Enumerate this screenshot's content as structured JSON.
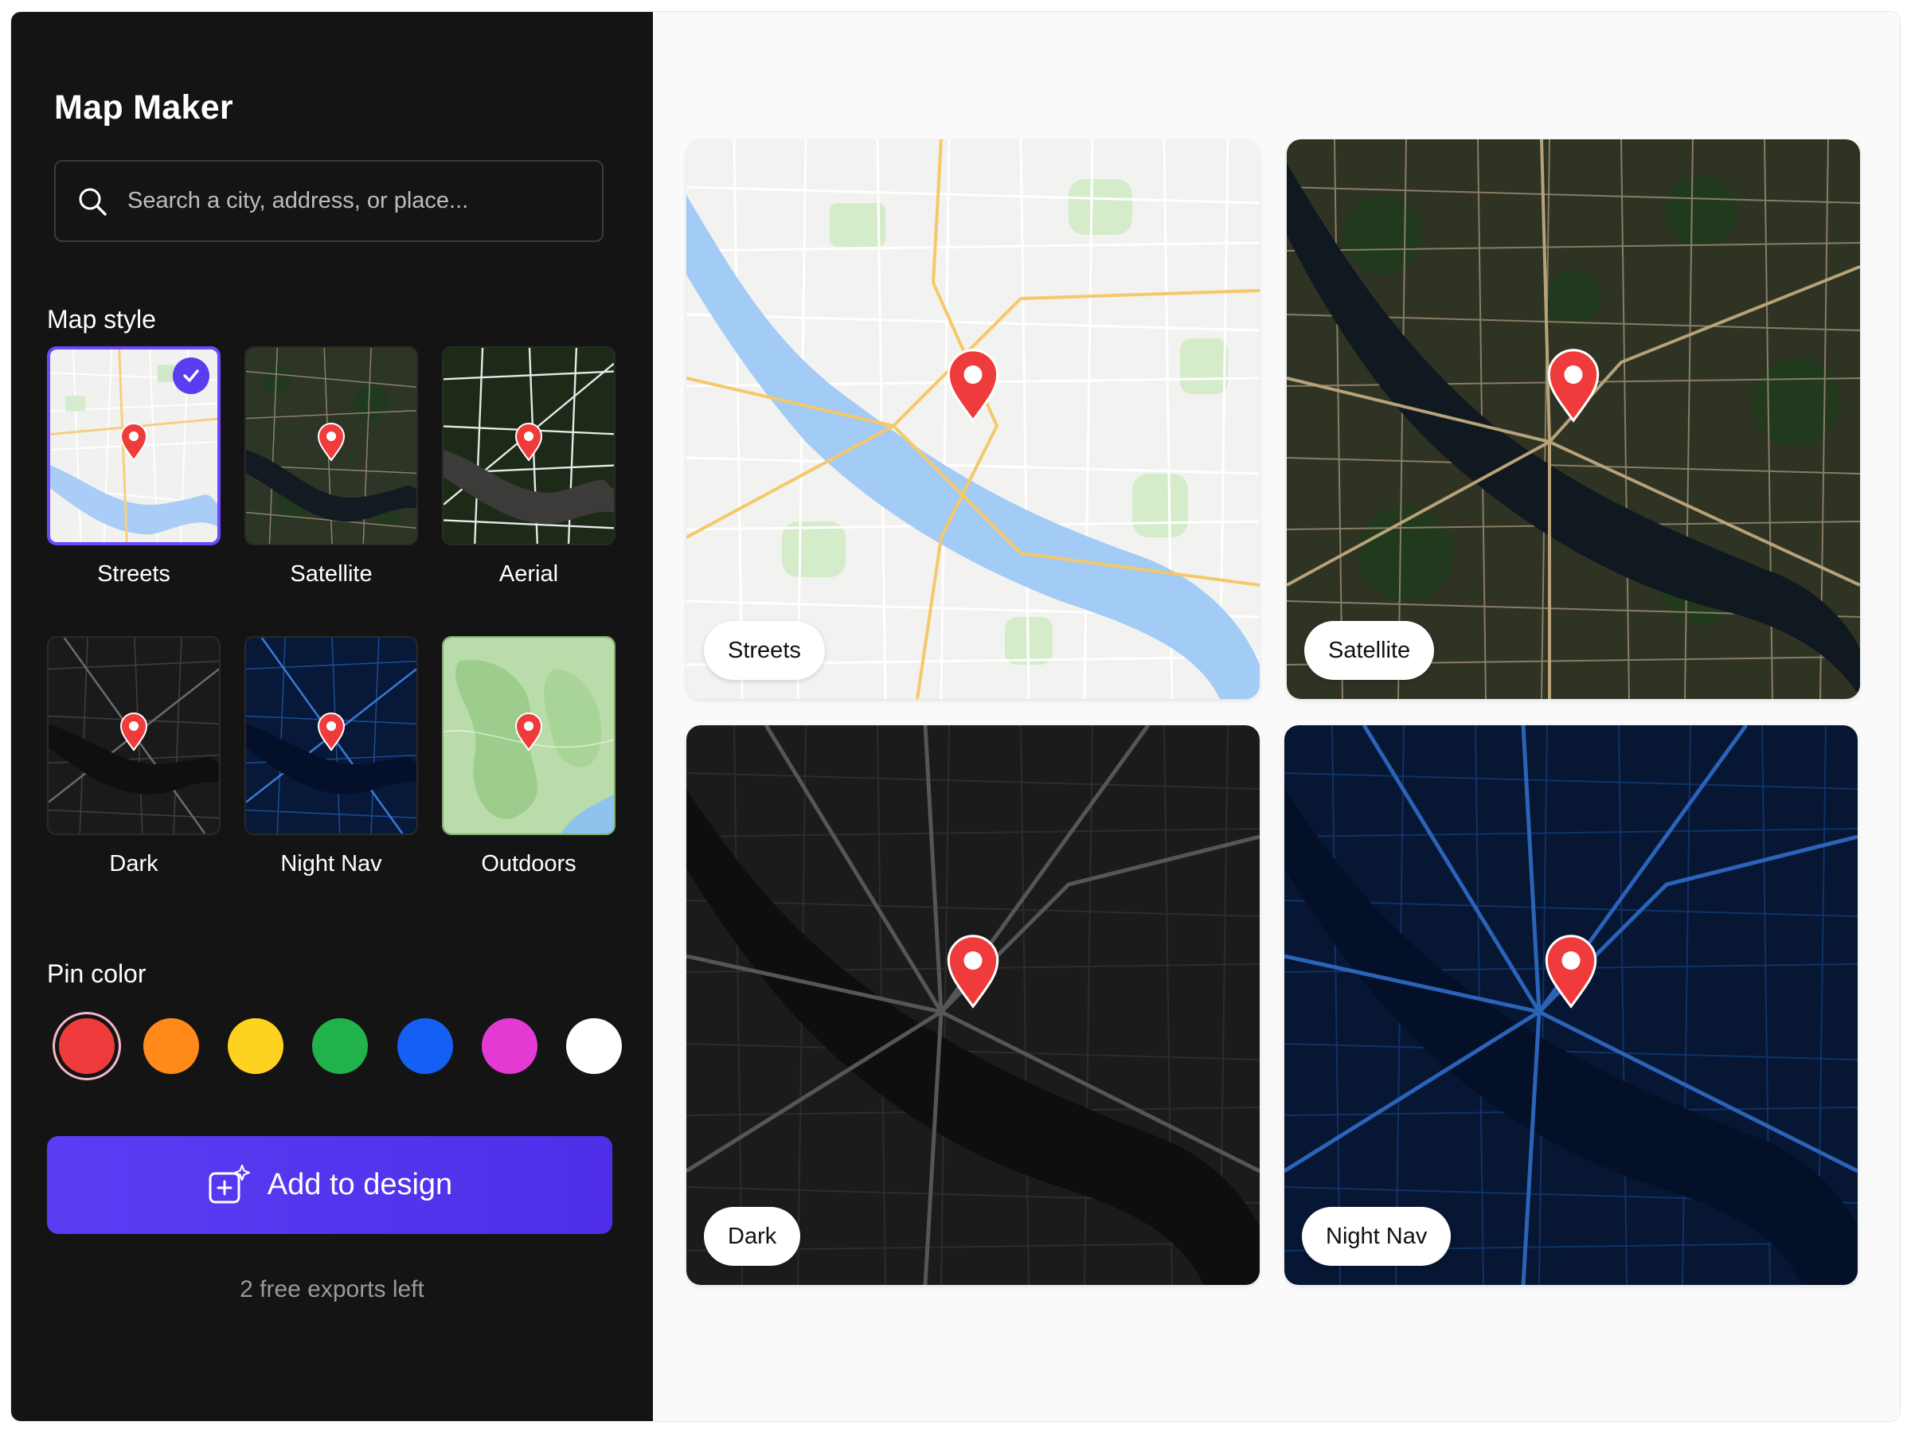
{
  "app": {
    "title": "Map Maker"
  },
  "search": {
    "placeholder": "Search a city, address, or place..."
  },
  "map_style": {
    "heading": "Map style",
    "selected": "Streets",
    "styles": [
      {
        "id": "streets",
        "label": "Streets",
        "selected": true
      },
      {
        "id": "satellite",
        "label": "Satellite",
        "selected": false
      },
      {
        "id": "aerial",
        "label": "Aerial",
        "selected": false
      },
      {
        "id": "dark",
        "label": "Dark",
        "selected": false
      },
      {
        "id": "night-nav",
        "label": "Night Nav",
        "selected": false
      },
      {
        "id": "outdoors",
        "label": "Outdoors",
        "selected": false
      }
    ]
  },
  "pin_color": {
    "heading": "Pin color",
    "selected": "#ef3b3b",
    "swatches": [
      "#ef3b3b",
      "#ff8a1a",
      "#ffd21f",
      "#22b24c",
      "#1460f5",
      "#e23ad3",
      "#ffffff"
    ]
  },
  "actions": {
    "add_label": "Add to design",
    "exports_left": "2 free exports left"
  },
  "previews": [
    {
      "label": "Streets"
    },
    {
      "label": "Satellite"
    },
    {
      "label": "Dark"
    },
    {
      "label": "Night Nav"
    }
  ],
  "colors": {
    "accent": "#5b3cf0",
    "sidebar_bg": "#141414",
    "pin": "#ef3b3b"
  },
  "icons": [
    "search-icon",
    "checkmark-icon",
    "map-pin-icon",
    "add-to-design-icon"
  ]
}
